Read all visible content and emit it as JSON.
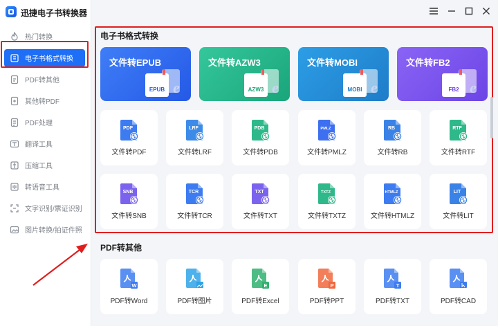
{
  "app": {
    "title": "迅捷电子书转换器"
  },
  "sidebar": {
    "items": [
      {
        "label": "热门转换",
        "icon": "fire-icon",
        "active": false
      },
      {
        "label": "电子书格式转换",
        "icon": "book-icon",
        "active": true
      },
      {
        "label": "PDF转其他",
        "icon": "pdf-export-icon",
        "active": false
      },
      {
        "label": "其他转PDF",
        "icon": "pdf-import-icon",
        "active": false
      },
      {
        "label": "PDF处理",
        "icon": "pdf-tools-icon",
        "active": false
      },
      {
        "label": "翻译工具",
        "icon": "translate-icon",
        "active": false
      },
      {
        "label": "压缩工具",
        "icon": "compress-icon",
        "active": false
      },
      {
        "label": "转语音工具",
        "icon": "voice-icon",
        "active": false
      },
      {
        "label": "文字识别/票证识别",
        "icon": "ocr-icon",
        "active": false
      },
      {
        "label": "图片转换/拍证件照",
        "icon": "image-icon",
        "active": false
      }
    ]
  },
  "window_controls": [
    "menu-icon",
    "minimize-icon",
    "maximize-icon",
    "close-icon"
  ],
  "sections": {
    "ebook": {
      "title": "电子书格式转换",
      "features": [
        {
          "label": "文件转EPUB",
          "tag": "EPUB",
          "color_from": "#3f7ef7",
          "color_to": "#2559e6"
        },
        {
          "label": "文件转AZW3",
          "tag": "AZW3",
          "color_from": "#35c79c",
          "color_to": "#1aa57a"
        },
        {
          "label": "文件转MOBI",
          "tag": "MOBI",
          "color_from": "#2c9ee6",
          "color_to": "#1f7cc8"
        },
        {
          "label": "文件转FB2",
          "tag": "FB2",
          "color_from": "#8a64f5",
          "color_to": "#6c45e6"
        }
      ],
      "tools": [
        {
          "label": "文件转PDF",
          "tag": "PDF",
          "color": "#3d7cf0"
        },
        {
          "label": "文件转LRF",
          "tag": "LRF",
          "color": "#3d8be8"
        },
        {
          "label": "文件转PDB",
          "tag": "PDB",
          "color": "#2fb88a"
        },
        {
          "label": "文件转PMLZ",
          "tag": "PMLZ",
          "color": "#3d6ff0"
        },
        {
          "label": "文件转RB",
          "tag": "RB",
          "color": "#3b82e6"
        },
        {
          "label": "文件转RTF",
          "tag": "RTF",
          "color": "#2fb88a"
        },
        {
          "label": "文件转SNB",
          "tag": "SNB",
          "color": "#7b63ee"
        },
        {
          "label": "文件转TCR",
          "tag": "TCR",
          "color": "#3d7cf0"
        },
        {
          "label": "文件转TXT",
          "tag": "TXT",
          "color": "#7b63ee"
        },
        {
          "label": "文件转TXTZ",
          "tag": "TXTZ",
          "color": "#2fb88a"
        },
        {
          "label": "文件转HTMLZ",
          "tag": "HTMLZ",
          "color": "#3d7cf0"
        },
        {
          "label": "文件转LIT",
          "tag": "LIT",
          "color": "#3b82e6"
        }
      ]
    },
    "pdf": {
      "title": "PDF转其他",
      "tools": [
        {
          "label": "PDF转Word",
          "badge": "W",
          "color": "#3d7cf0"
        },
        {
          "label": "PDF转图片",
          "badge": "img",
          "color": "#2ea3e8"
        },
        {
          "label": "PDF转Excel",
          "badge": "E",
          "color": "#2fb070"
        },
        {
          "label": "PDF转PPT",
          "badge": "P",
          "color": "#f0673d"
        },
        {
          "label": "PDF转TXT",
          "badge": "T",
          "color": "#3d7cf0"
        },
        {
          "label": "PDF转CAD",
          "badge": "cad",
          "color": "#3d7cf0"
        }
      ]
    }
  },
  "colors": {
    "accent": "#1e6ef6",
    "highlight": "#e01e1e",
    "background": "#f3f5f9"
  }
}
